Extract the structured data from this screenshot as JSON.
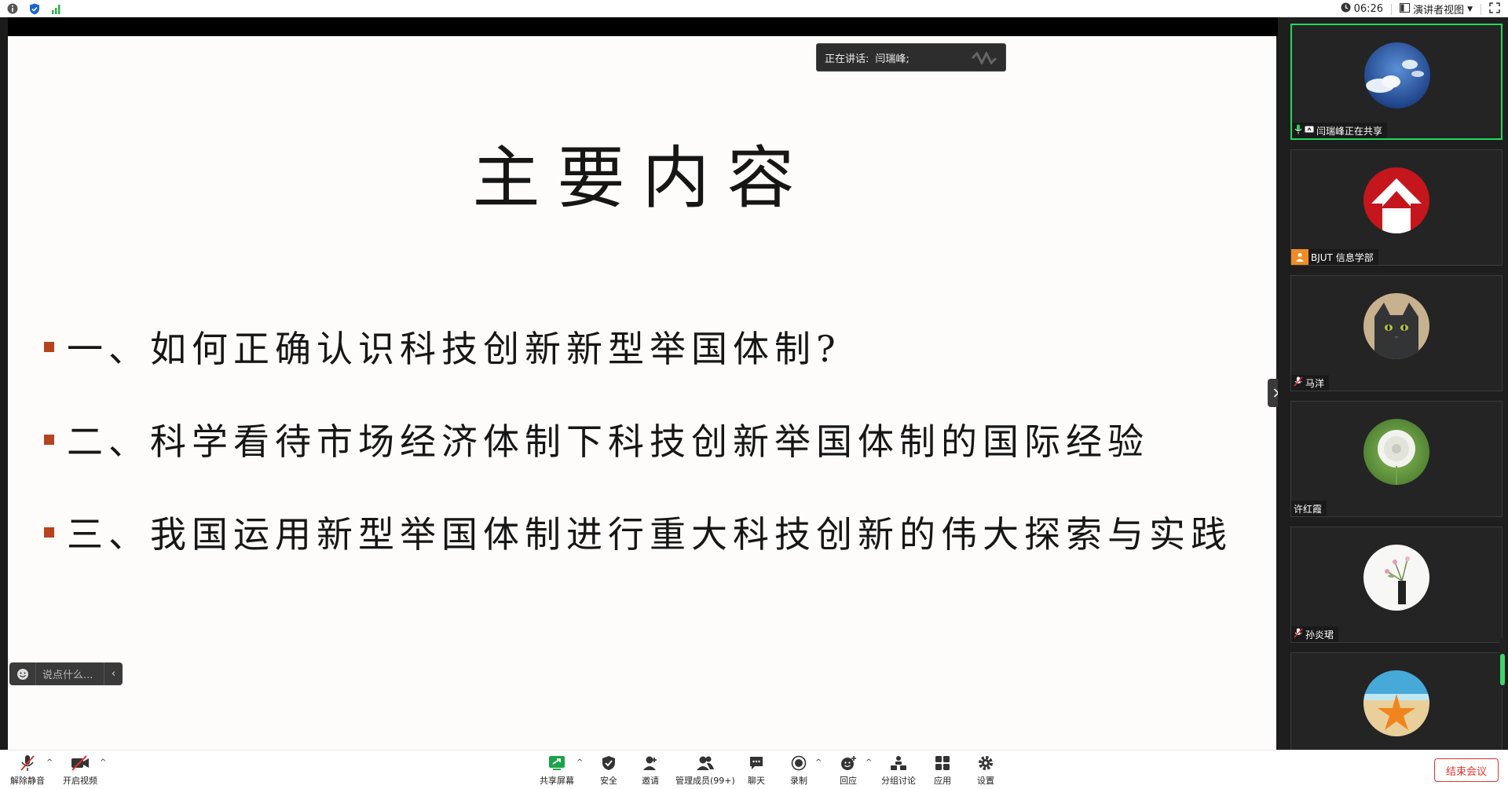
{
  "topbar": {
    "left_icons": [
      "info-icon",
      "shield-check-icon",
      "signal-bars-icon"
    ],
    "timer": "06:26",
    "view_mode": "演讲者视图"
  },
  "slide": {
    "title": "主要内容",
    "bullets": [
      "一、如何正确认识科技创新新型举国体制?",
      "二、科学看待市场经济体制下科技创新举国体制的国际经验",
      "三、我国运用新型举国体制进行重大科技创新的伟大探索与实践"
    ]
  },
  "speaking": {
    "label": "正在讲话:",
    "name": "闫瑞峰;"
  },
  "chat": {
    "placeholder": "说点什么..."
  },
  "participants": [
    {
      "name": "闫瑞峰正在共享",
      "status_icons": [
        "mic-icon",
        "share-icon"
      ],
      "avatar": "sky-clouds-avatar",
      "active": true
    },
    {
      "name": "BJUT 信息学部",
      "status_icons": [
        "person-badge-icon"
      ],
      "avatar": "red-arrow-logo-avatar",
      "active": false
    },
    {
      "name": "马洋",
      "status_icons": [
        "mic-muted-icon"
      ],
      "avatar": "cat-avatar",
      "active": false
    },
    {
      "name": "许红霞",
      "status_icons": [],
      "avatar": "dandelion-avatar",
      "active": false
    },
    {
      "name": "孙炎珺",
      "status_icons": [
        "mic-muted-icon"
      ],
      "avatar": "flower-vase-avatar",
      "active": false
    },
    {
      "name": "",
      "status_icons": [],
      "avatar": "starfish-beach-avatar",
      "active": false
    }
  ],
  "toolbar": {
    "unmute": "解除静音",
    "start_video": "开启视频",
    "share_screen": "共享屏幕",
    "security": "安全",
    "invite": "邀请",
    "manage_members": "管理成员(99+)",
    "chat": "聊天",
    "record": "录制",
    "react": "回应",
    "breakout": "分组讨论",
    "apps": "应用",
    "settings": "设置",
    "end_meeting": "结束会议"
  },
  "colors": {
    "accent_green": "#23d959",
    "end_red": "#e0342f",
    "bullet_square": "#b5441e",
    "share_green": "#1aa34a"
  }
}
